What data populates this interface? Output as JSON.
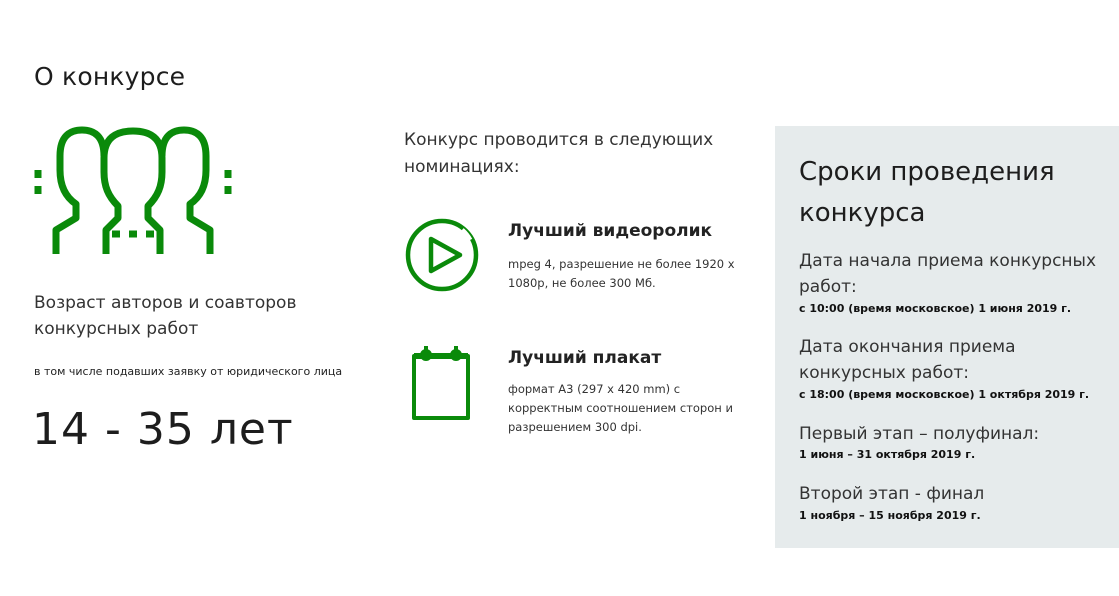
{
  "section": {
    "title": "О конкурсе"
  },
  "age": {
    "title": "Возраст авторов и соавторов конкурсных работ",
    "note": "в том числе подавших заявку от юридического лица",
    "value": "14 - 35 лет"
  },
  "nominations": {
    "intro": "Конкурс проводится в следующих номинациях:",
    "items": [
      {
        "title": "Лучший видеоролик",
        "description": "mpeg 4, разрешение не более 1920 х 1080р, не более 300 Мб.",
        "icon": "play-circle-icon"
      },
      {
        "title": "Лучший плакат",
        "description": "формат А3 (297 х 420 mm) с корректным соотношением сторон и разрешением 300 dpi.",
        "icon": "poster-icon"
      }
    ]
  },
  "schedule": {
    "title": "Сроки проведения конкурса",
    "items": [
      {
        "label": "Дата начала приема конкурсных работ:",
        "date": "с 10:00 (время московское) 1 июня 2019 г."
      },
      {
        "label": "Дата окончания приема конкурсных работ:",
        "date": "с 18:00 (время московское) 1 октября 2019 г."
      },
      {
        "label": "Первый этап – полуфинал:",
        "date": "1 июня – 31 октября 2019 г."
      },
      {
        "label": "Второй этап - финал",
        "date": "1 ноября – 15 ноября 2019 г."
      }
    ]
  },
  "colors": {
    "accent": "#0a8a0a",
    "panel": "#e6ebec",
    "text": "#222222"
  },
  "icons": {
    "people": "people-group-icon"
  }
}
